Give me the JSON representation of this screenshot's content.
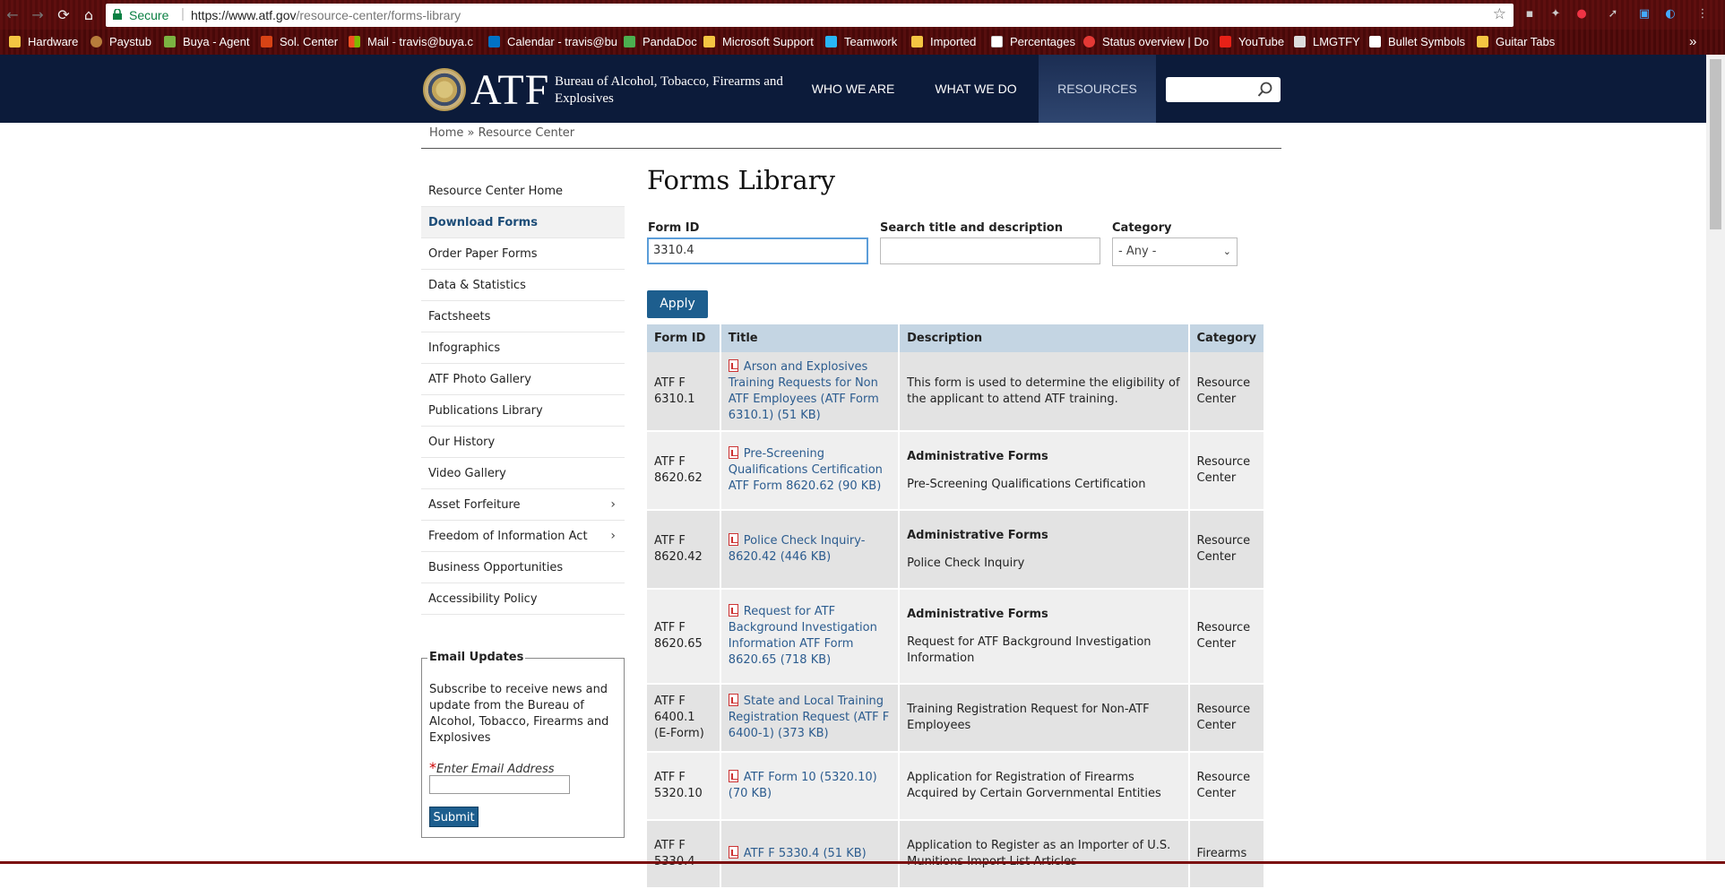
{
  "browser": {
    "secure_label": "Secure",
    "url_host": "https://www.atf.gov",
    "url_path": "/resource-center/forms-library",
    "bookmarks": [
      {
        "label": "Hardware",
        "icon": "folder-icon"
      },
      {
        "label": "Paystub",
        "icon": "paystub-icon"
      },
      {
        "label": "Buya - Agent",
        "icon": "agent-icon"
      },
      {
        "label": "Sol. Center",
        "icon": "b-icon"
      },
      {
        "label": "Mail - travis@buya.c",
        "icon": "windows-icon"
      },
      {
        "label": "Calendar - travis@bu",
        "icon": "outlook-icon"
      },
      {
        "label": "PandaDoc",
        "icon": "pandadoc-icon"
      },
      {
        "label": "Microsoft Support",
        "icon": "folder-icon"
      },
      {
        "label": "Teamwork",
        "icon": "teamwork-icon"
      },
      {
        "label": "Imported",
        "icon": "folder-icon"
      },
      {
        "label": "Percentages",
        "icon": "page-icon"
      },
      {
        "label": "Status overview | Do",
        "icon": "status-icon"
      },
      {
        "label": "YouTube",
        "icon": "youtube-icon"
      },
      {
        "label": "LMGTFY",
        "icon": "lmgtfy-icon"
      },
      {
        "label": "Bullet Symbols",
        "icon": "heart-icon"
      },
      {
        "label": "Guitar Tabs",
        "icon": "folder-icon"
      }
    ],
    "overflow": "»"
  },
  "header": {
    "logo": "ATF",
    "agency_name": "Bureau of Alcohol, Tobacco, Firearms and Explosives",
    "nav": [
      "WHO WE ARE",
      "WHAT WE DO",
      "RESOURCES"
    ],
    "active_nav": "RESOURCES",
    "search_placeholder": ""
  },
  "breadcrumb": {
    "home": "Home",
    "separator": "»",
    "current": "Resource Center"
  },
  "sidebar": {
    "items": [
      {
        "label": "Resource Center Home"
      },
      {
        "label": "Download Forms",
        "current": true
      },
      {
        "label": "Order Paper Forms"
      },
      {
        "label": "Data & Statistics"
      },
      {
        "label": "Factsheets"
      },
      {
        "label": "Infographics"
      },
      {
        "label": "ATF Photo Gallery"
      },
      {
        "label": "Publications Library"
      },
      {
        "label": "Our History"
      },
      {
        "label": "Video Gallery"
      },
      {
        "label": "Asset Forfeiture",
        "expandable": true
      },
      {
        "label": "Freedom of Information Act",
        "expandable": true
      },
      {
        "label": "Business Opportunities"
      },
      {
        "label": "Accessibility Policy"
      }
    ]
  },
  "email_updates": {
    "legend": "Email Updates",
    "text": "Subscribe to receive news and update from the Bureau of Alcohol, Tobacco, Firearms and Explosives",
    "required_mark": "*",
    "field_label": "Enter Email Address",
    "submit": "Submit"
  },
  "main": {
    "title": "Forms Library",
    "filters": {
      "form_id_label": "Form ID",
      "form_id_value": "3310.4",
      "search_label": "Search title and description",
      "search_value": "",
      "category_label": "Category",
      "category_value": "- Any -",
      "apply": "Apply"
    },
    "table": {
      "headers": [
        "Form ID",
        "Title",
        "Description",
        "Category"
      ],
      "rows": [
        {
          "id": "ATF F 6310.1",
          "title": "Arson and Explosives Training Requests for Non ATF Employees (ATF Form 6310.1) (51 KB)",
          "desc_head": "",
          "desc": "This form is used to determine the eligibility of the applicant to attend ATF training.",
          "category": "Resource Center"
        },
        {
          "id": "ATF F 8620.62",
          "title": "Pre-Screening Qualifications Certification ATF Form 8620.62 (90 KB)",
          "desc_head": "Administrative Forms",
          "desc": "Pre-Screening Qualifications Certification",
          "category": "Resource Center"
        },
        {
          "id": "ATF F 8620.42",
          "title": "Police Check Inquiry-8620.42 (446 KB)",
          "desc_head": "Administrative Forms",
          "desc": "Police Check Inquiry",
          "category": "Resource Center"
        },
        {
          "id": "ATF F 8620.65",
          "title": "Request for ATF Background Investigation Information ATF Form 8620.65 (718 KB)",
          "desc_head": "Administrative Forms",
          "desc": "Request for ATF Background Investigation Information",
          "category": "Resource Center"
        },
        {
          "id": "ATF F 6400.1 (E-Form)",
          "title": "State and Local Training Registration Request (ATF F 6400-1) (373 KB)",
          "desc_head": "",
          "desc": "Training Registration Request for Non-ATF Employees",
          "category": "Resource Center"
        },
        {
          "id": "ATF F 5320.10",
          "title": "ATF Form 10 (5320.10) (70 KB)",
          "desc_head": "",
          "desc": "Application for Registration of Firearms Acquired by Certain Gorvernmental Entities",
          "category": "Resource Center"
        },
        {
          "id": "ATF F 5330.4",
          "title": "ATF F 5330.4 (51 KB)",
          "desc_head": "",
          "desc": "Application to Register as an Importer of U.S. Munitions Import List Articles",
          "category": "Firearms"
        }
      ]
    }
  }
}
